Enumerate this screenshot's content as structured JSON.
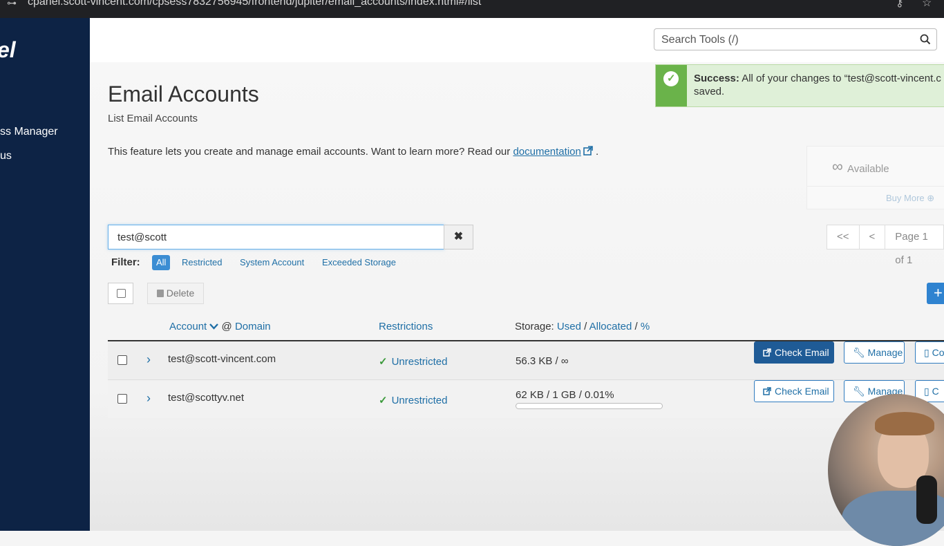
{
  "browser": {
    "url": "cpanel.scott-vincent.com/cpsess7832756945/frontend/jupiter/email_accounts/index.html#/list"
  },
  "sidebar": {
    "logo_text": "el",
    "items": [
      {
        "label": "ss Manager"
      },
      {
        "label": "us"
      }
    ]
  },
  "header": {
    "search": {
      "placeholder": "Search Tools (/)"
    }
  },
  "banner": {
    "prefix": "Success:",
    "message": "All of your changes to “test@scott-vincent.c",
    "message_line2": "saved."
  },
  "page": {
    "title": "Email Accounts",
    "subtitle": "List Email Accounts",
    "description": "This feature lets you create and manage email accounts. Want to learn more? Read our",
    "doc_link": "documentation",
    "doc_suffix": "."
  },
  "availability": {
    "symbol": "∞",
    "label": "Available",
    "buy_more": "Buy More ⊕"
  },
  "account_search": {
    "value": "test@scott",
    "clear_symbol": "✖"
  },
  "pagination": {
    "first": "<<",
    "prev": "<",
    "page_text": "Page 1 of 1"
  },
  "filter": {
    "label": "Filter:",
    "options": [
      "All",
      "Restricted",
      "System Account",
      "Exceeded Storage"
    ],
    "active": "All"
  },
  "bulk": {
    "delete_label": "Delete",
    "add_symbol": "+"
  },
  "table": {
    "headers": {
      "account": "Account",
      "at_sign": "@",
      "domain": "Domain",
      "restrictions": "Restrictions",
      "storage_prefix": "Storage:",
      "used": "Used",
      "allocated": "Allocated",
      "percent": "%"
    },
    "rows": [
      {
        "account": "test@scott-vincent.com",
        "restriction": "Unrestricted",
        "storage": "56.3 KB / ∞",
        "check_email": "Check Email",
        "manage": "Manage",
        "connect": "Co"
      },
      {
        "account": "test@scottyv.net",
        "restriction": "Unrestricted",
        "storage": "62 KB / 1 GB / 0.01%",
        "usage_fraction": 0.0001,
        "check_email": "Check Email",
        "manage": "Manage",
        "connect": "C"
      }
    ]
  },
  "colors": {
    "sidebar_bg": "#0d2345",
    "link": "#1f6fa6",
    "primary_button": "#1f5b96",
    "success_bar": "#6ab34a",
    "success_bg": "#dff0d8"
  }
}
